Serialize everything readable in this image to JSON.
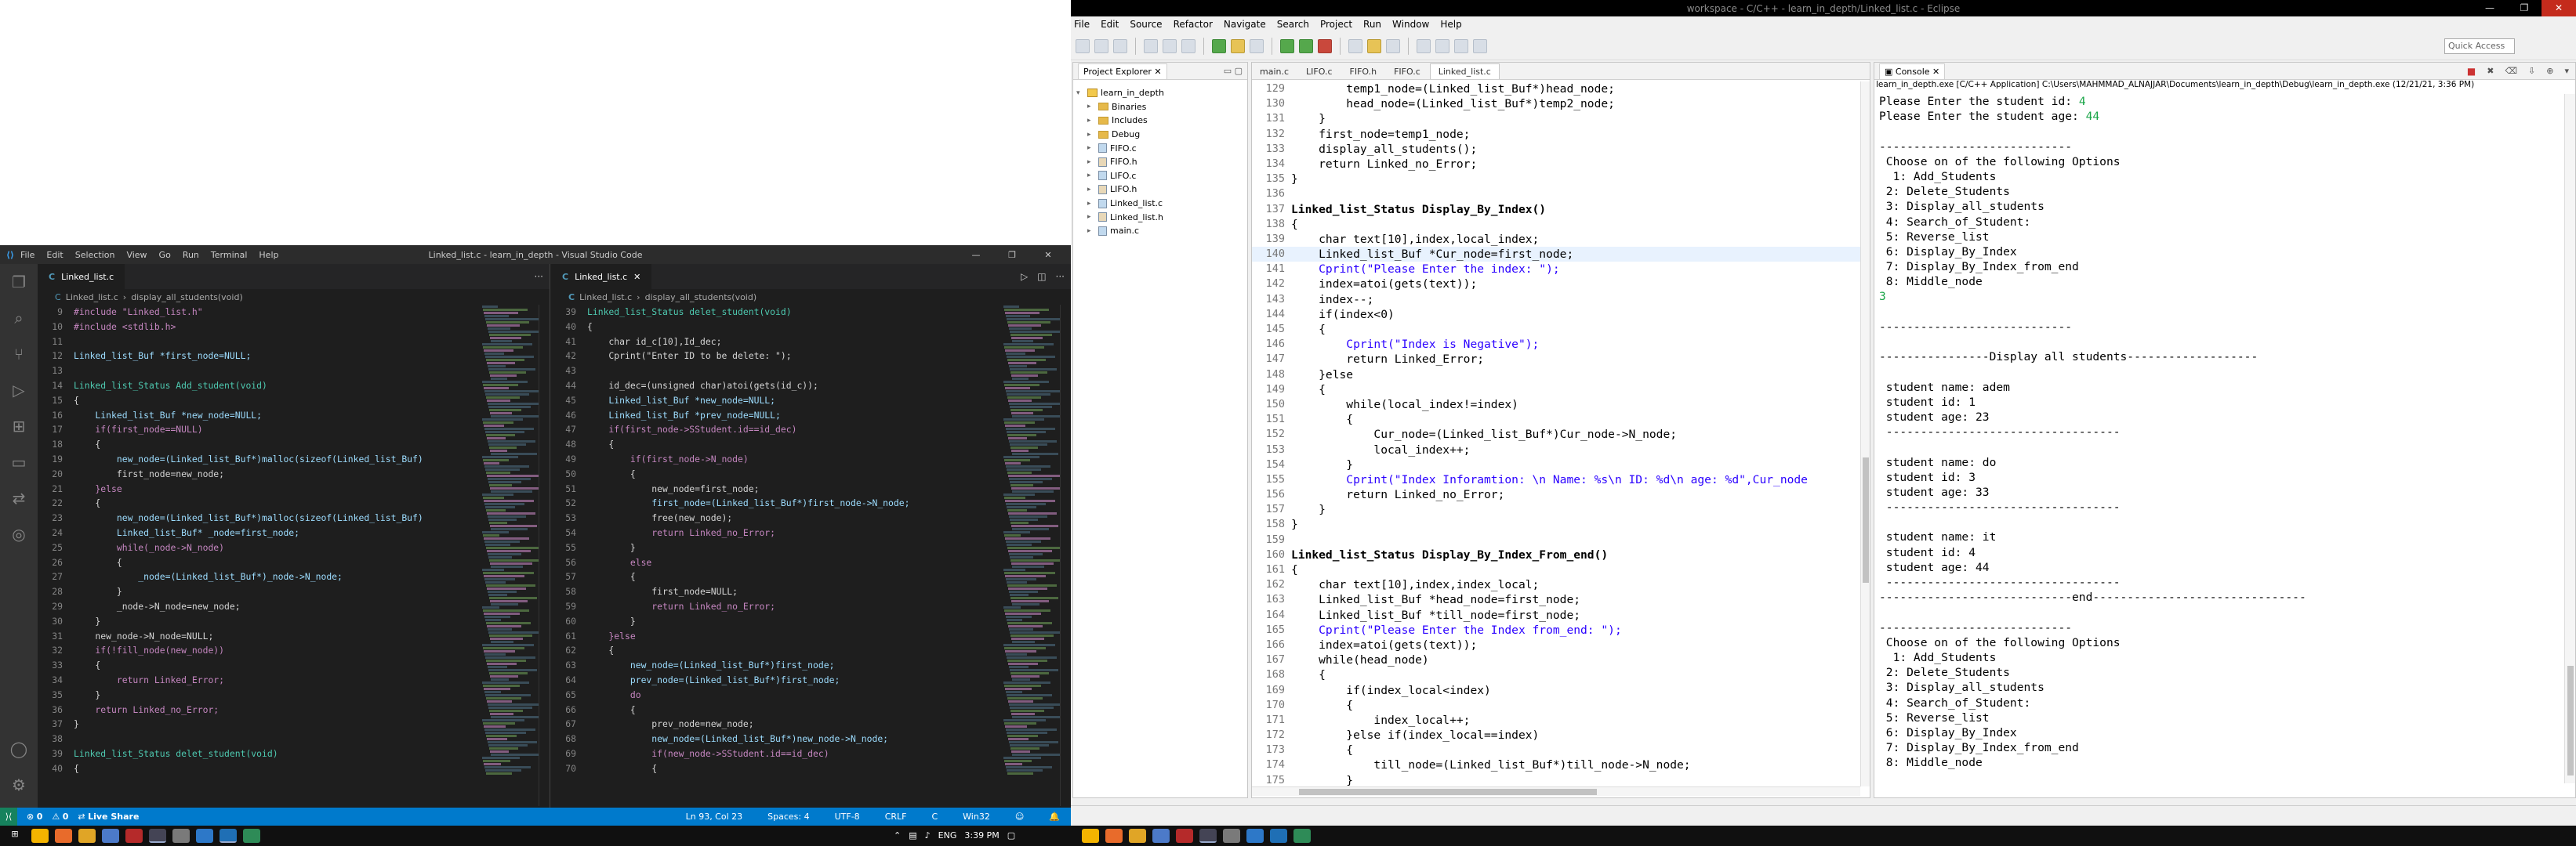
{
  "vscode": {
    "title": "Linked_list.c - learn_in_depth - Visual Studio Code",
    "menu": [
      "File",
      "Edit",
      "Selection",
      "View",
      "Go",
      "Run",
      "Terminal",
      "Help"
    ],
    "left": {
      "tab": "Linked_list.c",
      "breadcrumb_file": "Linked_list.c",
      "breadcrumb_sym": "display_all_students(void)",
      "lines": [
        {
          "n": "9",
          "c": "#include \"Linked_list.h\""
        },
        {
          "n": "10",
          "c": "#include <stdlib.h>"
        },
        {
          "n": "11",
          "c": ""
        },
        {
          "n": "12",
          "c": "Linked_list_Buf *first_node=NULL;"
        },
        {
          "n": "13",
          "c": ""
        },
        {
          "n": "14",
          "c": "Linked_list_Status Add_student(void)"
        },
        {
          "n": "15",
          "c": "{"
        },
        {
          "n": "16",
          "c": "    Linked_list_Buf *new_node=NULL;"
        },
        {
          "n": "17",
          "c": "    if(first_node==NULL)"
        },
        {
          "n": "18",
          "c": "    {"
        },
        {
          "n": "19",
          "c": "        new_node=(Linked_list_Buf*)malloc(sizeof(Linked_list_Buf)"
        },
        {
          "n": "20",
          "c": "        first_node=new_node;"
        },
        {
          "n": "21",
          "c": "    }else"
        },
        {
          "n": "22",
          "c": "    {"
        },
        {
          "n": "23",
          "c": "        new_node=(Linked_list_Buf*)malloc(sizeof(Linked_list_Buf)"
        },
        {
          "n": "24",
          "c": "        Linked_list_Buf* _node=first_node;"
        },
        {
          "n": "25",
          "c": "        while(_node->N_node)"
        },
        {
          "n": "26",
          "c": "        {"
        },
        {
          "n": "27",
          "c": "            _node=(Linked_list_Buf*)_node->N_node;"
        },
        {
          "n": "28",
          "c": "        }"
        },
        {
          "n": "29",
          "c": "        _node->N_node=new_node;"
        },
        {
          "n": "30",
          "c": "    }"
        },
        {
          "n": "31",
          "c": "    new_node->N_node=NULL;"
        },
        {
          "n": "32",
          "c": "    if(!fill_node(new_node))"
        },
        {
          "n": "33",
          "c": "    {"
        },
        {
          "n": "34",
          "c": "        return Linked_Error;"
        },
        {
          "n": "35",
          "c": "    }"
        },
        {
          "n": "36",
          "c": "    return Linked_no_Error;"
        },
        {
          "n": "37",
          "c": "}"
        },
        {
          "n": "38",
          "c": ""
        },
        {
          "n": "39",
          "c": "Linked_list_Status delet_student(void)"
        },
        {
          "n": "40",
          "c": "{"
        }
      ]
    },
    "right": {
      "tab": "Linked_list.c",
      "breadcrumb_file": "Linked_list.c",
      "breadcrumb_sym": "display_all_students(void)",
      "lines": [
        {
          "n": "39",
          "c": "Linked_list_Status delet_student(void)"
        },
        {
          "n": "40",
          "c": "{"
        },
        {
          "n": "41",
          "c": "    char id_c[10],Id_dec;"
        },
        {
          "n": "42",
          "c": "    Cprint(\"Enter ID to be delete: \");"
        },
        {
          "n": "43",
          "c": ""
        },
        {
          "n": "44",
          "c": "    id_dec=(unsigned char)atoi(gets(id_c));"
        },
        {
          "n": "45",
          "c": "    Linked_list_Buf *new_node=NULL;"
        },
        {
          "n": "46",
          "c": "    Linked_list_Buf *prev_node=NULL;"
        },
        {
          "n": "47",
          "c": "    if(first_node->SStudent.id==id_dec)"
        },
        {
          "n": "48",
          "c": "    {"
        },
        {
          "n": "49",
          "c": "        if(first_node->N_node)"
        },
        {
          "n": "50",
          "c": "        {"
        },
        {
          "n": "51",
          "c": "            new_node=first_node;"
        },
        {
          "n": "52",
          "c": "            first_node=(Linked_list_Buf*)first_node->N_node;"
        },
        {
          "n": "53",
          "c": "            free(new_node);"
        },
        {
          "n": "54",
          "c": "            return Linked_no_Error;"
        },
        {
          "n": "55",
          "c": "        }"
        },
        {
          "n": "56",
          "c": "        else"
        },
        {
          "n": "57",
          "c": "        {"
        },
        {
          "n": "58",
          "c": "            first_node=NULL;"
        },
        {
          "n": "59",
          "c": "            return Linked_no_Error;"
        },
        {
          "n": "60",
          "c": "        }"
        },
        {
          "n": "61",
          "c": "    }else"
        },
        {
          "n": "62",
          "c": "    {"
        },
        {
          "n": "63",
          "c": "        new_node=(Linked_list_Buf*)first_node;"
        },
        {
          "n": "64",
          "c": "        prev_node=(Linked_list_Buf*)first_node;"
        },
        {
          "n": "65",
          "c": "        do"
        },
        {
          "n": "66",
          "c": "        {"
        },
        {
          "n": "67",
          "c": "            prev_node=new_node;"
        },
        {
          "n": "68",
          "c": "            new_node=(Linked_list_Buf*)new_node->N_node;"
        },
        {
          "n": "69",
          "c": "            if(new_node->SStudent.id==id_dec)"
        },
        {
          "n": "70",
          "c": "            {"
        }
      ]
    },
    "status": {
      "live_share": "Live Share",
      "problems": "0",
      "warnings": "0",
      "position": "Ln 93, Col 23",
      "spaces": "Spaces: 4",
      "encoding": "UTF-8",
      "eol": "CRLF",
      "lang": "C",
      "platform": "Win32"
    }
  },
  "eclipse": {
    "title": "workspace - C/C++ - learn_in_depth/Linked_list.c - Eclipse",
    "menu": [
      "File",
      "Edit",
      "Source",
      "Refactor",
      "Navigate",
      "Search",
      "Project",
      "Run",
      "Window",
      "Help"
    ],
    "quick_access": "Quick Access",
    "explorer_title": "Project Explorer",
    "tree": [
      {
        "label": "learn_in_depth",
        "kind": "project",
        "indent": 0
      },
      {
        "label": "Binaries",
        "kind": "folder",
        "indent": 1
      },
      {
        "label": "Includes",
        "kind": "folder",
        "indent": 1
      },
      {
        "label": "Debug",
        "kind": "folder",
        "indent": 1
      },
      {
        "label": "FIFO.c",
        "kind": "c",
        "indent": 1
      },
      {
        "label": "FIFO.h",
        "kind": "h",
        "indent": 1
      },
      {
        "label": "LIFO.c",
        "kind": "c",
        "indent": 1
      },
      {
        "label": "LIFO.h",
        "kind": "h",
        "indent": 1
      },
      {
        "label": "Linked_list.c",
        "kind": "c",
        "indent": 1
      },
      {
        "label": "Linked_list.h",
        "kind": "h",
        "indent": 1
      },
      {
        "label": "main.c",
        "kind": "c",
        "indent": 1
      }
    ],
    "editor_tabs": [
      "main.c",
      "LIFO.c",
      "FIFO.h",
      "FIFO.c",
      "Linked_list.c"
    ],
    "editor_lines": [
      {
        "n": "129",
        "c": "        temp1_node=(Linked_list_Buf*)head_node;"
      },
      {
        "n": "130",
        "c": "        head_node=(Linked_list_Buf*)temp2_node;"
      },
      {
        "n": "131",
        "c": "    }"
      },
      {
        "n": "132",
        "c": "    first_node=temp1_node;"
      },
      {
        "n": "133",
        "c": "    display_all_students();"
      },
      {
        "n": "134",
        "c": "    return Linked_no_Error;"
      },
      {
        "n": "135",
        "c": "}"
      },
      {
        "n": "136",
        "c": ""
      },
      {
        "n": "137",
        "c": "Linked_list_Status Display_By_Index()"
      },
      {
        "n": "138",
        "c": "{"
      },
      {
        "n": "139",
        "c": "    char text[10],index,local_index;"
      },
      {
        "n": "140",
        "c": "    Linked_list_Buf *Cur_node=first_node;"
      },
      {
        "n": "141",
        "c": "    Cprint(\"Please Enter the index: \");"
      },
      {
        "n": "142",
        "c": "    index=atoi(gets(text));"
      },
      {
        "n": "143",
        "c": "    index--;"
      },
      {
        "n": "144",
        "c": "    if(index<0)"
      },
      {
        "n": "145",
        "c": "    {"
      },
      {
        "n": "146",
        "c": "        Cprint(\"Index is Negative\");"
      },
      {
        "n": "147",
        "c": "        return Linked_Error;"
      },
      {
        "n": "148",
        "c": "    }else"
      },
      {
        "n": "149",
        "c": "    {"
      },
      {
        "n": "150",
        "c": "        while(local_index!=index)"
      },
      {
        "n": "151",
        "c": "        {"
      },
      {
        "n": "152",
        "c": "            Cur_node=(Linked_list_Buf*)Cur_node->N_node;"
      },
      {
        "n": "153",
        "c": "            local_index++;"
      },
      {
        "n": "154",
        "c": "        }"
      },
      {
        "n": "155",
        "c": "        Cprint(\"Index Inforamtion: \\n Name: %s\\n ID: %d\\n age: %d\",Cur_node"
      },
      {
        "n": "156",
        "c": "        return Linked_no_Error;"
      },
      {
        "n": "157",
        "c": "    }"
      },
      {
        "n": "158",
        "c": "}"
      },
      {
        "n": "159",
        "c": ""
      },
      {
        "n": "160",
        "c": "Linked_list_Status Display_By_Index_From_end()"
      },
      {
        "n": "161",
        "c": "{"
      },
      {
        "n": "162",
        "c": "    char text[10],index,index_local;"
      },
      {
        "n": "163",
        "c": "    Linked_list_Buf *head_node=first_node;"
      },
      {
        "n": "164",
        "c": "    Linked_list_Buf *till_node=first_node;"
      },
      {
        "n": "165",
        "c": "    Cprint(\"Please Enter the Index from_end: \");"
      },
      {
        "n": "166",
        "c": "    index=atoi(gets(text));"
      },
      {
        "n": "167",
        "c": "    while(head_node)"
      },
      {
        "n": "168",
        "c": "    {"
      },
      {
        "n": "169",
        "c": "        if(index_local<index)"
      },
      {
        "n": "170",
        "c": "        {"
      },
      {
        "n": "171",
        "c": "            index_local++;"
      },
      {
        "n": "172",
        "c": "        }else if(index_local==index)"
      },
      {
        "n": "173",
        "c": "        {"
      },
      {
        "n": "174",
        "c": "            till_node=(Linked_list_Buf*)till_node->N_node;"
      },
      {
        "n": "175",
        "c": "        }"
      }
    ],
    "console_title": "Console",
    "console_path": "learn_in_depth.exe [C/C++ Application] C:\\Users\\MAHMMAD_ALNAJJAR\\Documents\\learn_in_depth\\Debug\\learn_in_depth.exe (12/21/21, 3:36 PM)",
    "console_lines": [
      {
        "t": "Please Enter the student id: ",
        "in": "4"
      },
      {
        "t": "Please Enter the student age: ",
        "in": "44"
      },
      {
        "t": "",
        "in": ""
      },
      {
        "t": "----------------------------",
        "in": ""
      },
      {
        "t": " Choose on of the following Options",
        "in": ""
      },
      {
        "t": "  1: Add_Students",
        "in": ""
      },
      {
        "t": " 2: Delete_Students",
        "in": ""
      },
      {
        "t": " 3: Display_all_students",
        "in": ""
      },
      {
        "t": " 4: Search_of_Student:",
        "in": ""
      },
      {
        "t": " 5: Reverse_list",
        "in": ""
      },
      {
        "t": " 6: Display_By_Index",
        "in": ""
      },
      {
        "t": " 7: Display_By_Index_from_end",
        "in": ""
      },
      {
        "t": " 8: Middle_node",
        "in": ""
      },
      {
        "t": "",
        "in": "3"
      },
      {
        "t": "",
        "in": ""
      },
      {
        "t": "----------------------------",
        "in": ""
      },
      {
        "t": "",
        "in": ""
      },
      {
        "t": "----------------Display all students-------------------",
        "in": ""
      },
      {
        "t": "",
        "in": ""
      },
      {
        "t": " student name: adem",
        "in": ""
      },
      {
        "t": " student id: 1",
        "in": ""
      },
      {
        "t": " student age: 23",
        "in": ""
      },
      {
        "t": " ----------------------------------",
        "in": ""
      },
      {
        "t": "",
        "in": ""
      },
      {
        "t": " student name: do",
        "in": ""
      },
      {
        "t": " student id: 3",
        "in": ""
      },
      {
        "t": " student age: 33",
        "in": ""
      },
      {
        "t": " ----------------------------------",
        "in": ""
      },
      {
        "t": "",
        "in": ""
      },
      {
        "t": " student name: it",
        "in": ""
      },
      {
        "t": " student id: 4",
        "in": ""
      },
      {
        "t": " student age: 44",
        "in": ""
      },
      {
        "t": " ----------------------------------",
        "in": ""
      },
      {
        "t": "----------------------------end-------------------------------",
        "in": ""
      },
      {
        "t": "",
        "in": ""
      },
      {
        "t": "----------------------------",
        "in": ""
      },
      {
        "t": " Choose on of the following Options",
        "in": ""
      },
      {
        "t": "  1: Add_Students",
        "in": ""
      },
      {
        "t": " 2: Delete_Students",
        "in": ""
      },
      {
        "t": " 3: Display_all_students",
        "in": ""
      },
      {
        "t": " 4: Search_of_Student:",
        "in": ""
      },
      {
        "t": " 5: Reverse_list",
        "in": ""
      },
      {
        "t": " 6: Display_By_Index",
        "in": ""
      },
      {
        "t": " 7: Display_By_Index_from_end",
        "in": ""
      },
      {
        "t": " 8: Middle_node",
        "in": ""
      }
    ]
  },
  "taskbar": {
    "lang": "ENG",
    "time": "3:39 PM"
  }
}
